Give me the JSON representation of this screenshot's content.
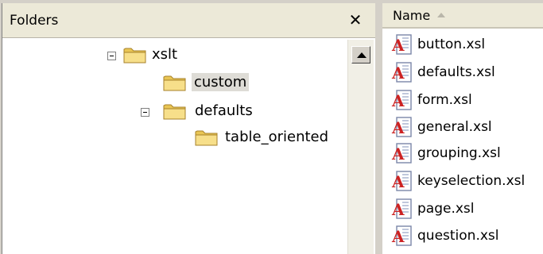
{
  "folders_pane": {
    "title": "Folders",
    "close_glyph": "✕",
    "tree": {
      "xslt": "xslt",
      "custom": "custom",
      "defaults": "defaults",
      "table_oriented": "table_oriented"
    }
  },
  "files_pane": {
    "column_header": "Name",
    "sort": "ascending",
    "files": [
      "button.xsl",
      "defaults.xsl",
      "form.xsl",
      "general.xsl",
      "grouping.xsl",
      "keyselection.xsl",
      "page.xsl",
      "question.xsl"
    ]
  },
  "icons": {
    "folder": "folder-icon",
    "xsl_file": "xsl-file-icon",
    "collapse": "collapse-minus-icon",
    "scroll_up": "scroll-up-arrow-icon",
    "close": "close-icon"
  },
  "colors": {
    "folder_yellow": "#f3d77a",
    "file_red": "#cc2222",
    "header_bg": "#ece9d8"
  }
}
